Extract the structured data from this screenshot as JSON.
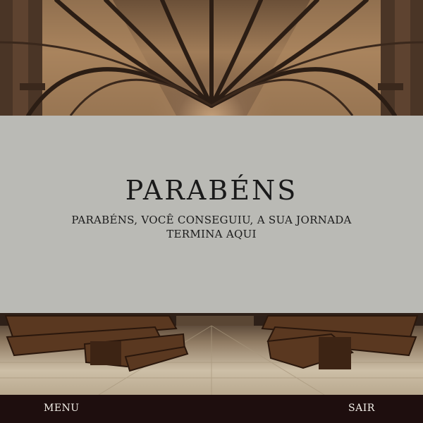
{
  "ending": {
    "title": "PARABÉNS",
    "message_line1": "PARABÉNS, VOCÊ CONSEGUIU, A SUA JORNADA",
    "message_line2": "TERMINA AQUI"
  },
  "navbar": {
    "menu_label": "MENU",
    "exit_label": "SAIR"
  },
  "colors": {
    "panel_background": "#babab5",
    "navbar_background": "#1e0e0e",
    "text_dark": "#1a1a1a",
    "text_light": "#f2efe8"
  }
}
